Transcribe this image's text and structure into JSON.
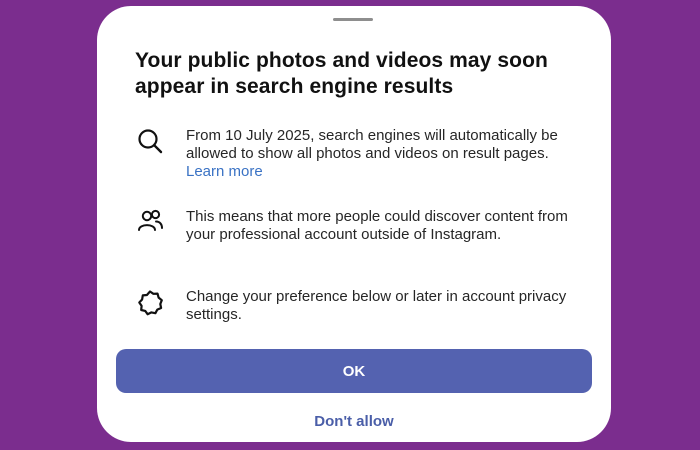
{
  "dialog": {
    "title": "Your public photos and videos may soon appear in search engine results",
    "items": [
      {
        "icon": "search-icon",
        "text": "From 10 July 2025, search engines will automatically be allowed to show all photos and videos on result pages.",
        "link": "Learn more"
      },
      {
        "icon": "people-icon",
        "text": "This means that more people could discover content from your professional account outside of Instagram."
      },
      {
        "icon": "settings-gear-icon",
        "text": "Change your preference below or later in account privacy settings."
      }
    ],
    "primary_button": "OK",
    "secondary_button": "Don't allow"
  },
  "colors": {
    "background": "#7b2d8e",
    "primary_button": "#5462b0",
    "link": "#3a72c4"
  }
}
